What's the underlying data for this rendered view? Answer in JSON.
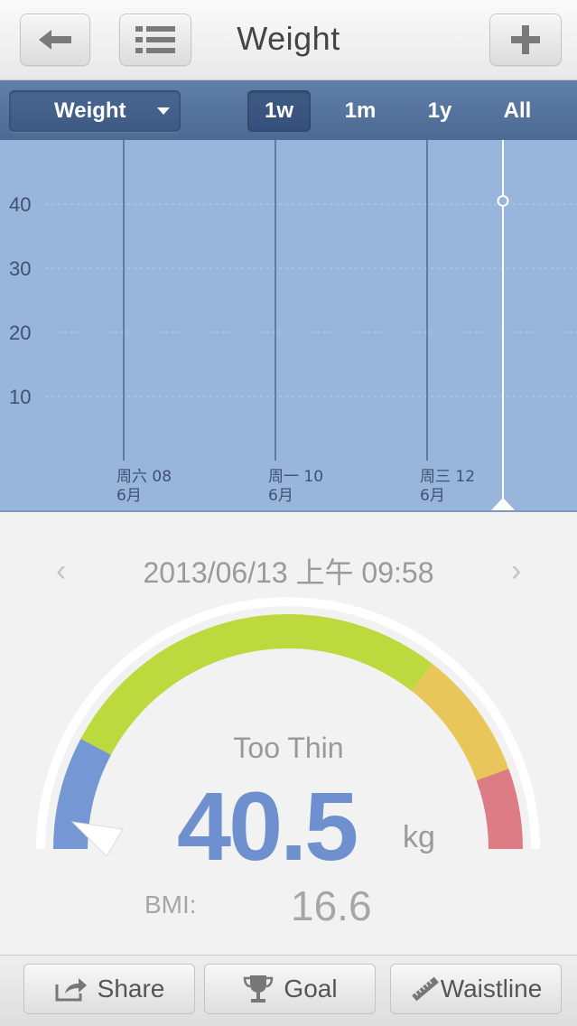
{
  "header": {
    "title": "Weight"
  },
  "toolbar": {
    "metric_selected": "Weight",
    "ranges": [
      "1w",
      "1m",
      "1y",
      "All"
    ],
    "active_range": "1w"
  },
  "chart_data": {
    "type": "line",
    "yticks": [
      10,
      20,
      30,
      40
    ],
    "ylim": [
      0,
      50
    ],
    "xticks": [
      {
        "day": "周六 08",
        "month": "6月"
      },
      {
        "day": "周一 10",
        "month": "6月"
      },
      {
        "day": "周三 12",
        "month": "6月"
      }
    ],
    "points": [
      {
        "x": "2013-06-13",
        "y": 40.5
      }
    ],
    "grid": true
  },
  "detail": {
    "datetime": "2013/06/13 上午 09:58",
    "status": "Too Thin",
    "weight": "40.5",
    "unit": "kg",
    "bmi_label": "BMI:",
    "bmi_value": "16.6",
    "prev_arrow": "‹",
    "next_arrow": "›"
  },
  "bottombar": {
    "share_label": "Share",
    "goal_label": "Goal",
    "waistline_label": "Waistline"
  },
  "colors": {
    "chart_bg": "#98b6dc",
    "gauge_blue": "#7598d4",
    "gauge_green": "#bcd93d",
    "gauge_yellow": "#e8c65a",
    "gauge_red": "#de7c86",
    "value_blue": "#6f90cf"
  }
}
